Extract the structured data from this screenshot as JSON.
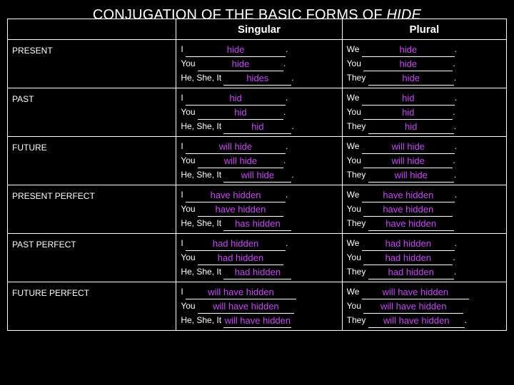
{
  "title": {
    "prefix": "CONJUGATION OF THE BASIC FORMS OF ",
    "verb": "HIDE"
  },
  "header": {
    "blank_label": "",
    "singular": "Singular",
    "plural": "Plural"
  },
  "period": ".",
  "rows": [
    {
      "label": "PRESENT",
      "singular": [
        {
          "subject": "I",
          "answer": "hide",
          "period": "."
        },
        {
          "subject": "You",
          "answer": "hide",
          "period": "."
        },
        {
          "subject": "He, She, It",
          "answer": "hides",
          "period": "."
        }
      ],
      "plural": [
        {
          "subject": "We",
          "answer": "hide",
          "period": "."
        },
        {
          "subject": "You",
          "answer": "hide",
          "period": "."
        },
        {
          "subject": "They",
          "answer": "hide",
          "period": "."
        }
      ]
    },
    {
      "label": "PAST",
      "singular": [
        {
          "subject": "I",
          "answer": "hid",
          "period": "."
        },
        {
          "subject": "You",
          "answer": "hid",
          "period": "."
        },
        {
          "subject": "He, She, It",
          "answer": "hid",
          "period": "."
        }
      ],
      "plural": [
        {
          "subject": "We",
          "answer": "hid",
          "period": "."
        },
        {
          "subject": "You",
          "answer": "hid",
          "period": "."
        },
        {
          "subject": "They",
          "answer": "hid",
          "period": "."
        }
      ]
    },
    {
      "label": "FUTURE",
      "singular": [
        {
          "subject": "I",
          "answer": "will hide",
          "period": "."
        },
        {
          "subject": "You",
          "answer": "will hide",
          "period": "."
        },
        {
          "subject": "He, She, It",
          "answer": "will hide",
          "period": "."
        }
      ],
      "plural": [
        {
          "subject": "We",
          "answer": "will hide",
          "period": "."
        },
        {
          "subject": "You",
          "answer": "will hide",
          "period": "."
        },
        {
          "subject": "They",
          "answer": "will hide",
          "period": "."
        }
      ]
    },
    {
      "label": "PRESENT PERFECT",
      "singular": [
        {
          "subject": "I",
          "answer": "have hidden",
          "period": "."
        },
        {
          "subject": "You",
          "answer": "have hidden",
          "period": ""
        },
        {
          "subject": "He, She, It",
          "answer": "has hidden",
          "period": ""
        }
      ],
      "plural": [
        {
          "subject": "We",
          "answer": "have hidden",
          "period": "."
        },
        {
          "subject": "You",
          "answer": "have hidden",
          "period": ""
        },
        {
          "subject": "They",
          "answer": "have hidden",
          "period": ""
        }
      ]
    },
    {
      "label": "PAST PERFECT",
      "singular": [
        {
          "subject": "I",
          "answer": "had hidden",
          "period": "."
        },
        {
          "subject": "You",
          "answer": "had hidden",
          "period": ""
        },
        {
          "subject": "He, She, It",
          "answer": "had hidden",
          "period": ""
        }
      ],
      "plural": [
        {
          "subject": "We",
          "answer": "had hidden",
          "period": "."
        },
        {
          "subject": "You",
          "answer": "had hidden",
          "period": "."
        },
        {
          "subject": "They",
          "answer": "had hidden",
          "period": "."
        }
      ]
    },
    {
      "label": "FUTURE PERFECT",
      "singular": [
        {
          "subject": "I",
          "answer": "will have hidden",
          "period": ""
        },
        {
          "subject": "You",
          "answer": "will have hidden",
          "period": ""
        },
        {
          "subject": "He, She, It",
          "answer": "will have hidden",
          "period": ""
        }
      ],
      "plural": [
        {
          "subject": "We",
          "answer": "will have hidden",
          "period": ""
        },
        {
          "subject": "You",
          "answer": "will have hidden",
          "period": ""
        },
        {
          "subject": "They",
          "answer": "will have hidden",
          "period": "."
        }
      ]
    }
  ],
  "colors": {
    "background": "#000000",
    "text": "#ffffff",
    "answer": "#c44df0"
  }
}
